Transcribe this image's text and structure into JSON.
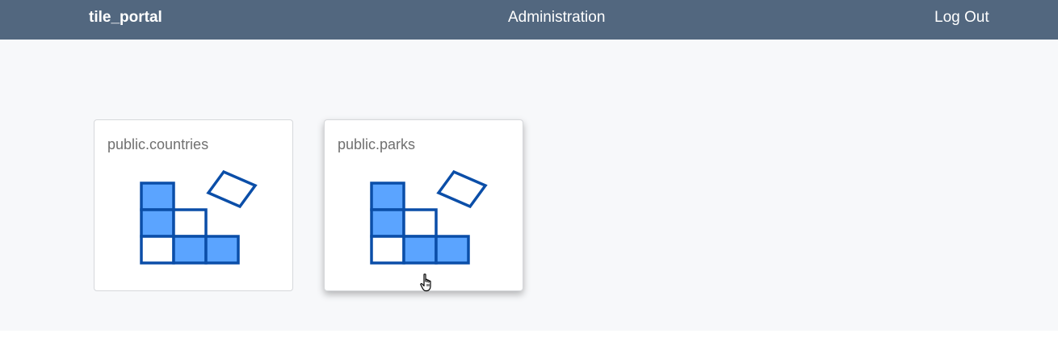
{
  "navbar": {
    "brand": "tile_portal",
    "admin_label": "Administration",
    "logout_label": "Log Out"
  },
  "layers": [
    {
      "name": "public.countries",
      "icon": "tile-layer-icon"
    },
    {
      "name": "public.parks",
      "icon": "tile-layer-icon"
    }
  ],
  "colors": {
    "navbar_bg": "#52677f",
    "content_bg": "#f7f8fa",
    "icon_fill": "#5ba4ff",
    "icon_stroke": "#0b4ea8"
  }
}
